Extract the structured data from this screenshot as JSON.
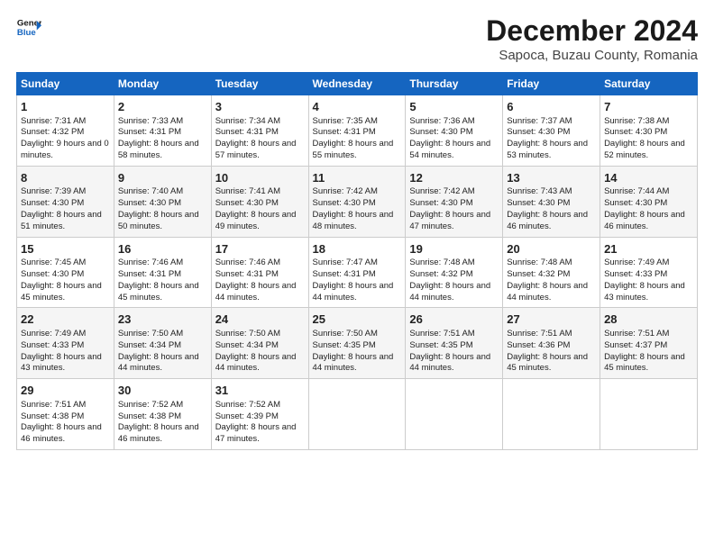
{
  "header": {
    "logo_line1": "General",
    "logo_line2": "Blue",
    "title": "December 2024",
    "subtitle": "Sapoca, Buzau County, Romania"
  },
  "columns": [
    "Sunday",
    "Monday",
    "Tuesday",
    "Wednesday",
    "Thursday",
    "Friday",
    "Saturday"
  ],
  "weeks": [
    [
      {
        "day": "1",
        "rise": "7:31 AM",
        "set": "4:32 PM",
        "daylight": "9 hours and 0 minutes."
      },
      {
        "day": "2",
        "rise": "7:33 AM",
        "set": "4:31 PM",
        "daylight": "8 hours and 58 minutes."
      },
      {
        "day": "3",
        "rise": "7:34 AM",
        "set": "4:31 PM",
        "daylight": "8 hours and 57 minutes."
      },
      {
        "day": "4",
        "rise": "7:35 AM",
        "set": "4:31 PM",
        "daylight": "8 hours and 55 minutes."
      },
      {
        "day": "5",
        "rise": "7:36 AM",
        "set": "4:30 PM",
        "daylight": "8 hours and 54 minutes."
      },
      {
        "day": "6",
        "rise": "7:37 AM",
        "set": "4:30 PM",
        "daylight": "8 hours and 53 minutes."
      },
      {
        "day": "7",
        "rise": "7:38 AM",
        "set": "4:30 PM",
        "daylight": "8 hours and 52 minutes."
      }
    ],
    [
      {
        "day": "8",
        "rise": "7:39 AM",
        "set": "4:30 PM",
        "daylight": "8 hours and 51 minutes."
      },
      {
        "day": "9",
        "rise": "7:40 AM",
        "set": "4:30 PM",
        "daylight": "8 hours and 50 minutes."
      },
      {
        "day": "10",
        "rise": "7:41 AM",
        "set": "4:30 PM",
        "daylight": "8 hours and 49 minutes."
      },
      {
        "day": "11",
        "rise": "7:42 AM",
        "set": "4:30 PM",
        "daylight": "8 hours and 48 minutes."
      },
      {
        "day": "12",
        "rise": "7:42 AM",
        "set": "4:30 PM",
        "daylight": "8 hours and 47 minutes."
      },
      {
        "day": "13",
        "rise": "7:43 AM",
        "set": "4:30 PM",
        "daylight": "8 hours and 46 minutes."
      },
      {
        "day": "14",
        "rise": "7:44 AM",
        "set": "4:30 PM",
        "daylight": "8 hours and 46 minutes."
      }
    ],
    [
      {
        "day": "15",
        "rise": "7:45 AM",
        "set": "4:30 PM",
        "daylight": "8 hours and 45 minutes."
      },
      {
        "day": "16",
        "rise": "7:46 AM",
        "set": "4:31 PM",
        "daylight": "8 hours and 45 minutes."
      },
      {
        "day": "17",
        "rise": "7:46 AM",
        "set": "4:31 PM",
        "daylight": "8 hours and 44 minutes."
      },
      {
        "day": "18",
        "rise": "7:47 AM",
        "set": "4:31 PM",
        "daylight": "8 hours and 44 minutes."
      },
      {
        "day": "19",
        "rise": "7:48 AM",
        "set": "4:32 PM",
        "daylight": "8 hours and 44 minutes."
      },
      {
        "day": "20",
        "rise": "7:48 AM",
        "set": "4:32 PM",
        "daylight": "8 hours and 44 minutes."
      },
      {
        "day": "21",
        "rise": "7:49 AM",
        "set": "4:33 PM",
        "daylight": "8 hours and 43 minutes."
      }
    ],
    [
      {
        "day": "22",
        "rise": "7:49 AM",
        "set": "4:33 PM",
        "daylight": "8 hours and 43 minutes."
      },
      {
        "day": "23",
        "rise": "7:50 AM",
        "set": "4:34 PM",
        "daylight": "8 hours and 44 minutes."
      },
      {
        "day": "24",
        "rise": "7:50 AM",
        "set": "4:34 PM",
        "daylight": "8 hours and 44 minutes."
      },
      {
        "day": "25",
        "rise": "7:50 AM",
        "set": "4:35 PM",
        "daylight": "8 hours and 44 minutes."
      },
      {
        "day": "26",
        "rise": "7:51 AM",
        "set": "4:35 PM",
        "daylight": "8 hours and 44 minutes."
      },
      {
        "day": "27",
        "rise": "7:51 AM",
        "set": "4:36 PM",
        "daylight": "8 hours and 45 minutes."
      },
      {
        "day": "28",
        "rise": "7:51 AM",
        "set": "4:37 PM",
        "daylight": "8 hours and 45 minutes."
      }
    ],
    [
      {
        "day": "29",
        "rise": "7:51 AM",
        "set": "4:38 PM",
        "daylight": "8 hours and 46 minutes."
      },
      {
        "day": "30",
        "rise": "7:52 AM",
        "set": "4:38 PM",
        "daylight": "8 hours and 46 minutes."
      },
      {
        "day": "31",
        "rise": "7:52 AM",
        "set": "4:39 PM",
        "daylight": "8 hours and 47 minutes."
      },
      null,
      null,
      null,
      null
    ]
  ]
}
